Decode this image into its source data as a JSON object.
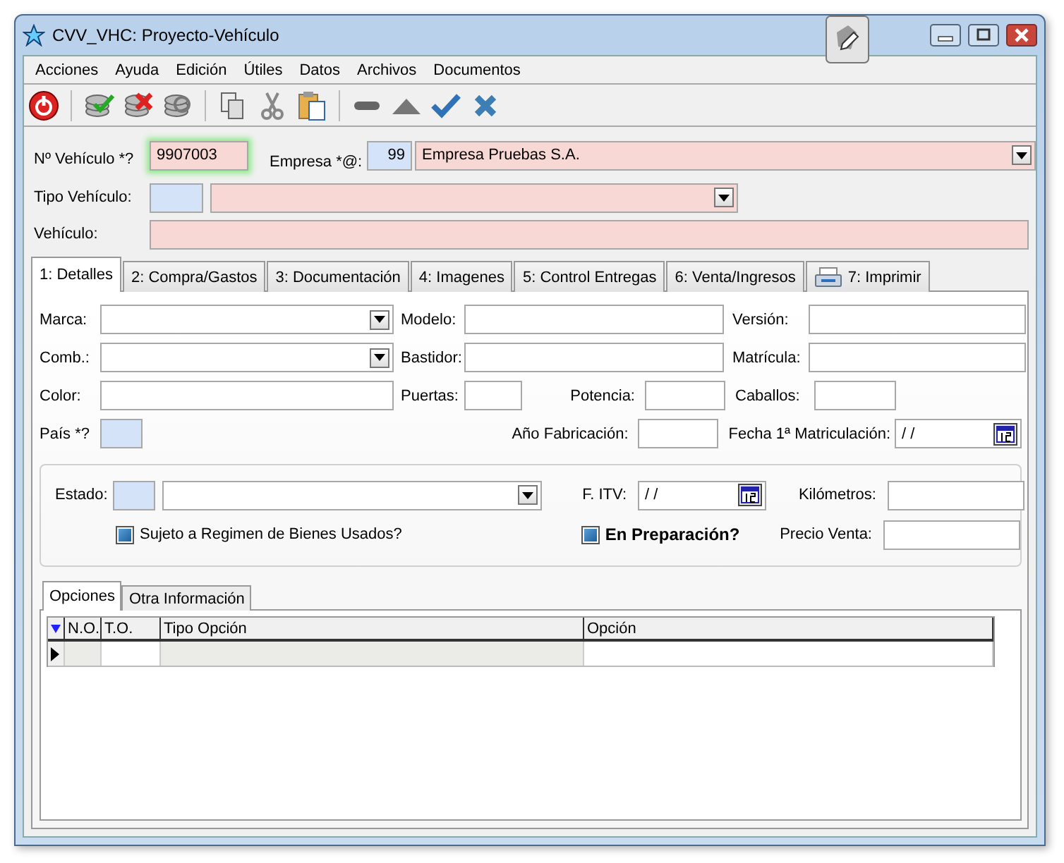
{
  "window": {
    "title": "CVV_VHC: Proyecto-Vehículo"
  },
  "menu": [
    "Acciones",
    "Ayuda",
    "Edición",
    "Útiles",
    "Datos",
    "Archivos",
    "Documentos"
  ],
  "header": {
    "vehicle_number": {
      "label": "Nº Vehículo *?",
      "value": "9907003",
      "focused": true
    },
    "company": {
      "label": "Empresa *@:",
      "code": "99",
      "value": "Empresa Pruebas S.A."
    },
    "vehicle_type": {
      "label": "Tipo Vehículo:"
    },
    "vehicle": {
      "label": "Vehículo:"
    }
  },
  "tabs": [
    {
      "label": "1: Detalles",
      "selected": true
    },
    {
      "label": "2: Compra/Gastos",
      "selected": false
    },
    {
      "label": "3: Documentación",
      "selected": false
    },
    {
      "label": "4: Imagenes",
      "selected": false
    },
    {
      "label": "5: Control Entregas",
      "selected": false
    },
    {
      "label": "6: Venta/Ingresos",
      "selected": false
    },
    {
      "label": "7: Imprimir",
      "selected": false,
      "kind": "print"
    }
  ],
  "details": {
    "brand": "Marca:",
    "model": "Modelo:",
    "version": "Versión:",
    "fuel": "Comb.:",
    "chassis": "Bastidor:",
    "plate": "Matrícula:",
    "paint": "Color:",
    "doors": "Puertas:",
    "power": "Potencia:",
    "horsepower": "Caballos:",
    "country": "País *?",
    "year": "Año Fabricación:",
    "first_registration": {
      "label": "Fecha 1ª Matriculación:",
      "value": "/ /"
    }
  },
  "status_group": {
    "state": "Estado:",
    "itv": {
      "label": "F. ITV:",
      "value": "/ /"
    },
    "kilometers": "Kilómetros:",
    "sale_price": "Precio Venta:",
    "checkboxes": [
      {
        "label": "Sujeto a Regimen de Bienes Usados?",
        "checked": true,
        "bold": false
      },
      {
        "label": "En Preparación?",
        "checked": true,
        "bold": true
      }
    ]
  },
  "subtabs": [
    {
      "label": "Opciones",
      "selected": true
    },
    {
      "label": "Otra Información",
      "selected": false
    }
  ],
  "grid": {
    "columns": [
      "N.O.",
      "T.O.",
      "Tipo Opción",
      "Opción"
    ]
  }
}
